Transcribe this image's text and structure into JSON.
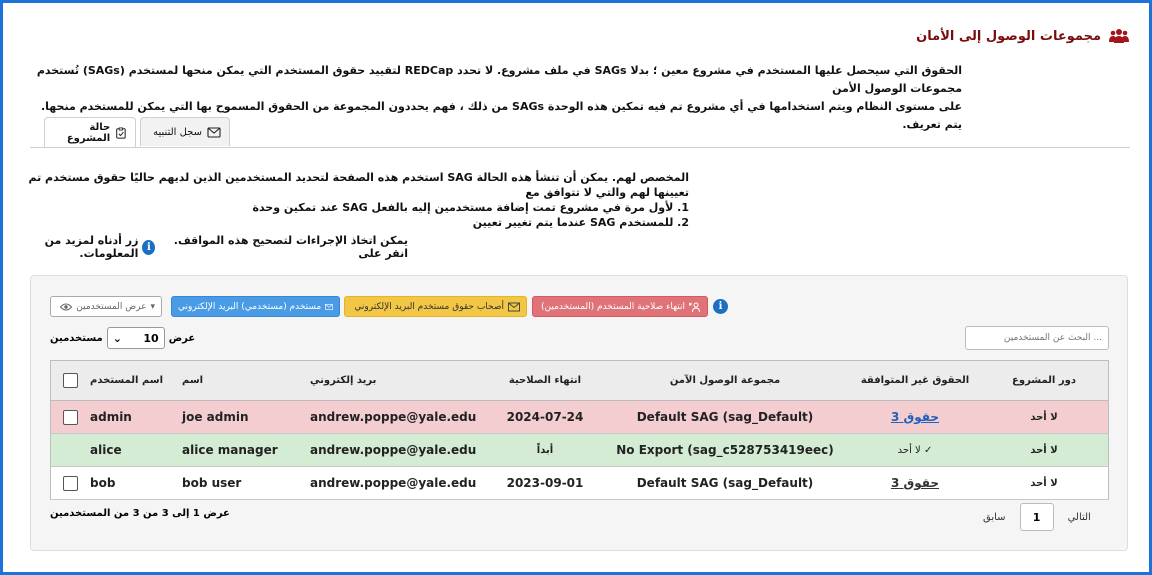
{
  "page": {
    "title": "مجموعات الوصول إلى الأمان",
    "description_line1": "الحقوق التي سيحصل عليها المستخدم في مشروع معين ؛ بدلا SAGs في ملف مشروع. لا تحدد REDCap لتقييد حقوق المستخدم التي يمكن منحها لمستخدم (SAGs) تُستخدم مجموعات الوصول الأمن",
    "description_line2": "على مستوى النظام ويتم استخدامها في أي مشروع تم فيه تمكين هذه الوحدة SAGs من ذلك ، فهم يحددون المجموعة من الحقوق المسموح بها التي يمكن للمستخدم منحها. يتم تعريف."
  },
  "tabs": {
    "status": "حالة المشروع",
    "log": "سجل التنبيه"
  },
  "info": {
    "intro": "المخصص لهم. يمكن أن تنشأ هذه الحالة SAG استخدم هذه الصفحة لتحديد المستخدمين الذين لديهم حاليًا حقوق مستخدم تم تعيينها لهم والتي لا تتوافق مع",
    "item1": "1. لأول مرة في مشروع تمت إضافة مستخدمين إليه بالفعل SAG عند تمكين وحدة",
    "item2": "2. للمستخدم SAG عندما يتم تغيير تعيين",
    "more_before": "يمكن اتخاذ الإجراءات لتصحيح هذه المواقف. انقر على",
    "more_after": "زر أدناه لمزيد من المعلومات."
  },
  "actions": {
    "info_icon": "i",
    "expire": "انتهاء صلاحية المستخدم (المستخدمين)",
    "email_rights_holders": "أصحاب حقوق مستخدم البريد الإلكتروني",
    "email_users": "مستخدم (مستخدمي) البريد الإلكتروني",
    "view_users": "عرض المستخدمين"
  },
  "controls": {
    "show_label": "عرض",
    "page_length": "10",
    "users_label": "مستخدمين",
    "search_placeholder": "... البحث عن المستخدمين"
  },
  "table": {
    "headers": {
      "project_role": "دور المشروع",
      "noncompliant": "الحقوق غير المتوافقة",
      "sag": "مجموعة الوصول الآمن",
      "expiration": "انتهاء الصلاحية",
      "email": "بريد إلكتروني",
      "name": "اسم",
      "username": "اسم المستخدم"
    },
    "rows": [
      {
        "username": "admin",
        "name": "joe admin",
        "email": "andrew.poppe@yale.edu",
        "expiration": "2024-07-24",
        "sag": "Default SAG (sag_Default)",
        "noncompliant": "حقوق 3",
        "role": "لا أحد"
      },
      {
        "username": "alice",
        "name": "alice manager",
        "email": "andrew.poppe@yale.edu",
        "expiration": "أبداً",
        "sag": "No Export (sag_c528753419eec)",
        "noncompliant": "لا أحد",
        "role": "لا أحد"
      },
      {
        "username": "bob",
        "name": "bob user",
        "email": "andrew.poppe@yale.edu",
        "expiration": "2023-09-01",
        "sag": "Default SAG (sag_Default)",
        "noncompliant": "حقوق 3",
        "role": "لا أحد"
      }
    ]
  },
  "footer": {
    "summary": "عرض 1 إلى 3 من 3 من المستخدمين",
    "next": "التالي",
    "current_page": "1",
    "previous": "سابق"
  },
  "colors": {
    "title": "#7b0c0c",
    "frame": "#1e73d8",
    "row_error": "#f4cdd1",
    "row_ok": "#d5ecd4"
  }
}
